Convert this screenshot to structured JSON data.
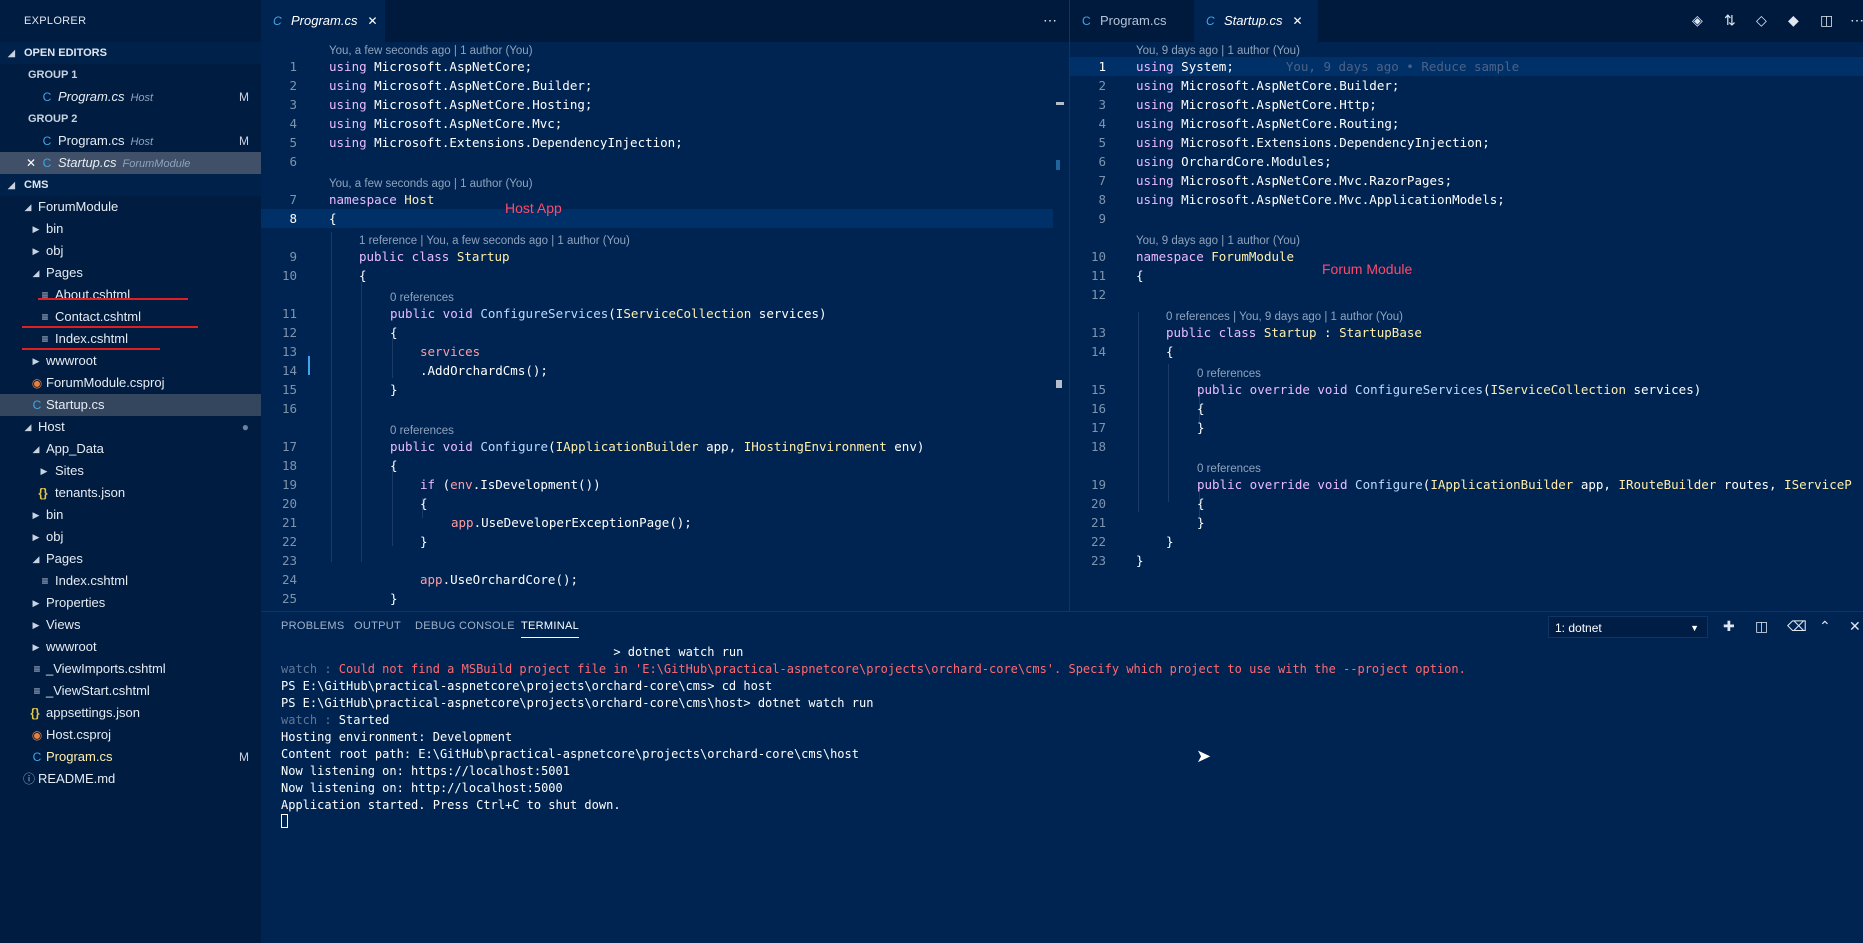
{
  "explorer": {
    "title": "EXPLORER",
    "open_editors": "OPEN EDITORS",
    "group1": "GROUP 1",
    "group2": "GROUP 2",
    "oe_g1_file": "Program.cs",
    "oe_g1_desc": "Host",
    "oe_g1_badge": "M",
    "oe_g2_file1": "Program.cs",
    "oe_g2_desc1": "Host",
    "oe_g2_badge1": "M",
    "oe_g2_file2": "Startup.cs",
    "oe_g2_desc2": "ForumModule",
    "cms": "CMS",
    "tree": {
      "forummodule": "ForumModule",
      "bin": "bin",
      "obj": "obj",
      "pages": "Pages",
      "about": "About.cshtml",
      "contact": "Contact.cshtml",
      "index": "Index.cshtml",
      "wwwroot": "wwwroot",
      "csproj": "ForumModule.csproj",
      "startup": "Startup.cs",
      "host": "Host",
      "app_data": "App_Data",
      "sites": "Sites",
      "tenants": "tenants.json",
      "h_bin": "bin",
      "h_obj": "obj",
      "h_pages": "Pages",
      "h_index": "Index.cshtml",
      "properties": "Properties",
      "views": "Views",
      "h_wwwroot": "wwwroot",
      "viewimports": "_ViewImports.cshtml",
      "viewstart": "_ViewStart.cshtml",
      "appsettings": "appsettings.json",
      "hostcsproj": "Host.csproj",
      "program": "Program.cs",
      "program_badge": "M",
      "readme": "README.md"
    }
  },
  "left_editor": {
    "tab": "Program.cs",
    "overlay": "Host App",
    "lenses": {
      "l0": "You, a few seconds ago | 1 author (You)",
      "l7": "You, a few seconds ago | 1 author (You)",
      "l9": "1 reference | You, a few seconds ago | 1 author (You)",
      "l11": "0 references",
      "l17": "0 references"
    },
    "numbers": [
      "1",
      "2",
      "3",
      "4",
      "5",
      "6",
      "7",
      "8",
      "9",
      "10",
      "11",
      "12",
      "13",
      "14",
      "15",
      "16",
      "17",
      "18",
      "19",
      "20",
      "21",
      "22",
      "23",
      "24",
      "25"
    ],
    "code": {
      "c1a": "using",
      "c1b": " Microsoft.AspNetCore;",
      "c2a": "using",
      "c2b": " Microsoft.AspNetCore.Builder;",
      "c3a": "using",
      "c3b": " Microsoft.AspNetCore.Hosting;",
      "c4a": "using",
      "c4b": " Microsoft.AspNetCore.Mvc;",
      "c5a": "using",
      "c5b": " Microsoft.Extensions.DependencyInjection;",
      "c7a": "namespace",
      "c7b": " Host",
      "c8": "{",
      "c9a": "public class",
      "c9b": " Startup",
      "c10": "{",
      "c11a": "public void",
      "c11b": " ConfigureServices",
      "c11c": "(",
      "c11d": "IServiceCollection",
      "c11e": " services)",
      "c12": "{",
      "c13": "services",
      "c14": ".AddOrchardCms();",
      "c15": "}",
      "c17a": "public void",
      "c17b": " Configure",
      "c17c": "(",
      "c17d": "IApplicationBuilder",
      "c17e": " app, ",
      "c17f": "IHostingEnvironment",
      "c17g": " env)",
      "c18": "{",
      "c19a": "if",
      "c19b": " (",
      "c19c": "env",
      "c19d": ".IsDevelopment())",
      "c20": "{",
      "c21a": "app",
      "c21b": ".UseDeveloperExceptionPage();",
      "c22": "}",
      "c24a": "app",
      "c24b": ".UseOrchardCore();",
      "c25": "}"
    }
  },
  "right_editor": {
    "tab1": "Program.cs",
    "tab2": "Startup.cs",
    "overlay": "Forum Module",
    "ghost": "You, 9 days ago • Reduce sample",
    "lenses": {
      "l0": "You, 9 days ago | 1 author (You)",
      "l10": "You, 9 days ago | 1 author (You)",
      "l13": "0 references | You, 9 days ago | 1 author (You)",
      "l15": "0 references",
      "l19": "0 references"
    },
    "numbers": [
      "1",
      "2",
      "3",
      "4",
      "5",
      "6",
      "7",
      "8",
      "9",
      "10",
      "11",
      "12",
      "13",
      "14",
      "15",
      "16",
      "17",
      "18",
      "19",
      "20",
      "21",
      "22",
      "23"
    ],
    "code": {
      "c1a": "using",
      "c1b": " System;",
      "c2a": "using",
      "c2b": " Microsoft.AspNetCore.Builder;",
      "c3a": "using",
      "c3b": " Microsoft.AspNetCore.Http;",
      "c4a": "using",
      "c4b": " Microsoft.AspNetCore.Routing;",
      "c5a": "using",
      "c5b": " Microsoft.Extensions.DependencyInjection;",
      "c6a": "using",
      "c6b": " OrchardCore.Modules;",
      "c7a": "using",
      "c7b": " Microsoft.AspNetCore.Mvc.RazorPages;",
      "c8a": "using",
      "c8b": " Microsoft.AspNetCore.Mvc.ApplicationModels;",
      "c10a": "namespace",
      "c10b": " ForumModule",
      "c11": "{",
      "c13a": "public class",
      "c13b": " Startup",
      "c13c": " : ",
      "c13d": "StartupBase",
      "c14": "{",
      "c15a": "public override void",
      "c15b": " ConfigureServices",
      "c15c": "(",
      "c15d": "IServiceCollection",
      "c15e": " services)",
      "c16": "{",
      "c17": "}",
      "c19a": "public override void",
      "c19b": " Configure",
      "c19c": "(",
      "c19d": "IApplicationBuilder",
      "c19e": " app, ",
      "c19f": "IRouteBuilder",
      "c19g": " routes, ",
      "c19h": "IServiceP",
      "c20": "{",
      "c21": "}",
      "c22": "}",
      "c23": "}"
    }
  },
  "panel": {
    "tabs": [
      "PROBLEMS",
      "OUTPUT",
      "DEBUG CONSOLE",
      "TERMINAL"
    ],
    "terminal_select": "1: dotnet",
    "lines": {
      "t0": "                                              > dotnet watch run",
      "t1a": "watch : ",
      "t1b": "Could not find a MSBuild project file in 'E:\\GitHub\\practical-aspnetcore\\projects\\orchard-core\\cms'. Specify which project to use with the --project option.",
      "t2": "PS E:\\GitHub\\practical-aspnetcore\\projects\\orchard-core\\cms> cd host",
      "t3": "PS E:\\GitHub\\practical-aspnetcore\\projects\\orchard-core\\cms\\host> dotnet watch run",
      "t4a": "watch : ",
      "t4b": "Started",
      "t5": "Hosting environment: Development",
      "t6": "Content root path: E:\\GitHub\\practical-aspnetcore\\projects\\orchard-core\\cms\\host",
      "t7": "Now listening on: https://localhost:5001",
      "t8": "Now listening on: http://localhost:5000",
      "t9": "Application started. Press Ctrl+C to shut down."
    }
  },
  "icons": {
    "cs": "csharp-file-icon",
    "md": "markup-file-icon",
    "rss": "project-file-icon",
    "json": "json-file-icon",
    "info": "info-icon"
  }
}
